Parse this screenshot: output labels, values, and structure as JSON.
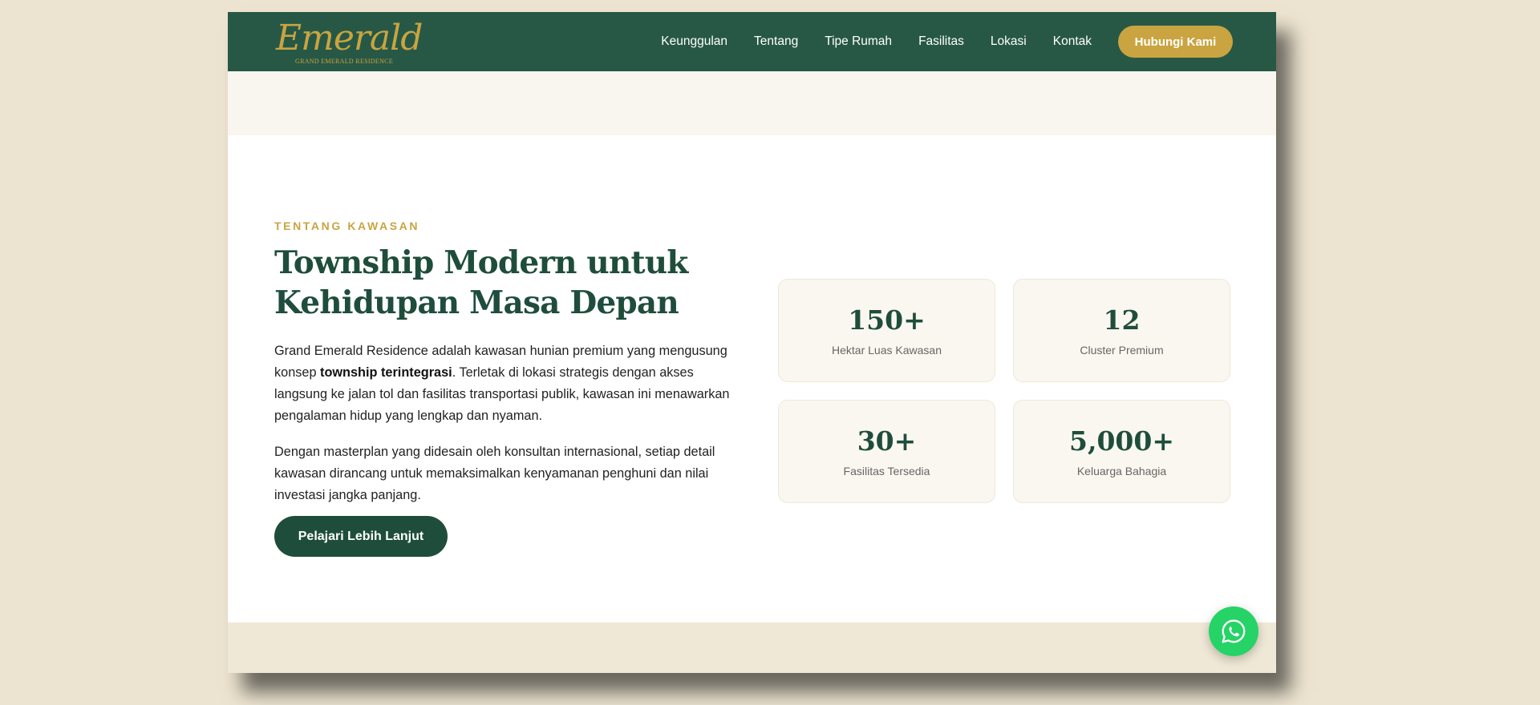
{
  "brand": {
    "logo_text": "Emerald",
    "logo_subtitle": "GRAND EMERALD RESIDENCE"
  },
  "nav": {
    "links": [
      {
        "label": "Keunggulan"
      },
      {
        "label": "Tentang"
      },
      {
        "label": "Tipe Rumah"
      },
      {
        "label": "Fasilitas"
      },
      {
        "label": "Lokasi"
      },
      {
        "label": "Kontak"
      }
    ],
    "cta_label": "Hubungi Kami"
  },
  "about": {
    "eyebrow": "TENTANG KAWASAN",
    "heading": "Township Modern untuk Kehidupan Masa Depan",
    "para1_before": "Grand Emerald Residence adalah kawasan hunian premium yang mengusung konsep ",
    "para1_bold": "township terintegrasi",
    "para1_after": ". Terletak di lokasi strategis dengan akses langsung ke jalan tol dan fasilitas transportasi publik, kawasan ini menawarkan pengalaman hidup yang lengkap dan nyaman.",
    "para2": "Dengan masterplan yang didesain oleh konsultan internasional, setiap detail kawasan dirancang untuk memaksimalkan kenyamanan penghuni dan nilai investasi jangka panjang.",
    "button_label": "Pelajari Lebih Lanjut"
  },
  "stats": [
    {
      "value": "150+",
      "label": "Hektar Luas Kawasan"
    },
    {
      "value": "12",
      "label": "Cluster Premium"
    },
    {
      "value": "30+",
      "label": "Fasilitas Tersedia"
    },
    {
      "value": "5,000+",
      "label": "Keluarga Bahagia"
    }
  ],
  "whatsapp": {
    "icon": "whatsapp-icon"
  },
  "colors": {
    "primary_green": "#275846",
    "dark_green": "#1f4d3c",
    "gold": "#c9a441",
    "whatsapp_green": "#25d366",
    "page_background": "#ece4d0"
  }
}
